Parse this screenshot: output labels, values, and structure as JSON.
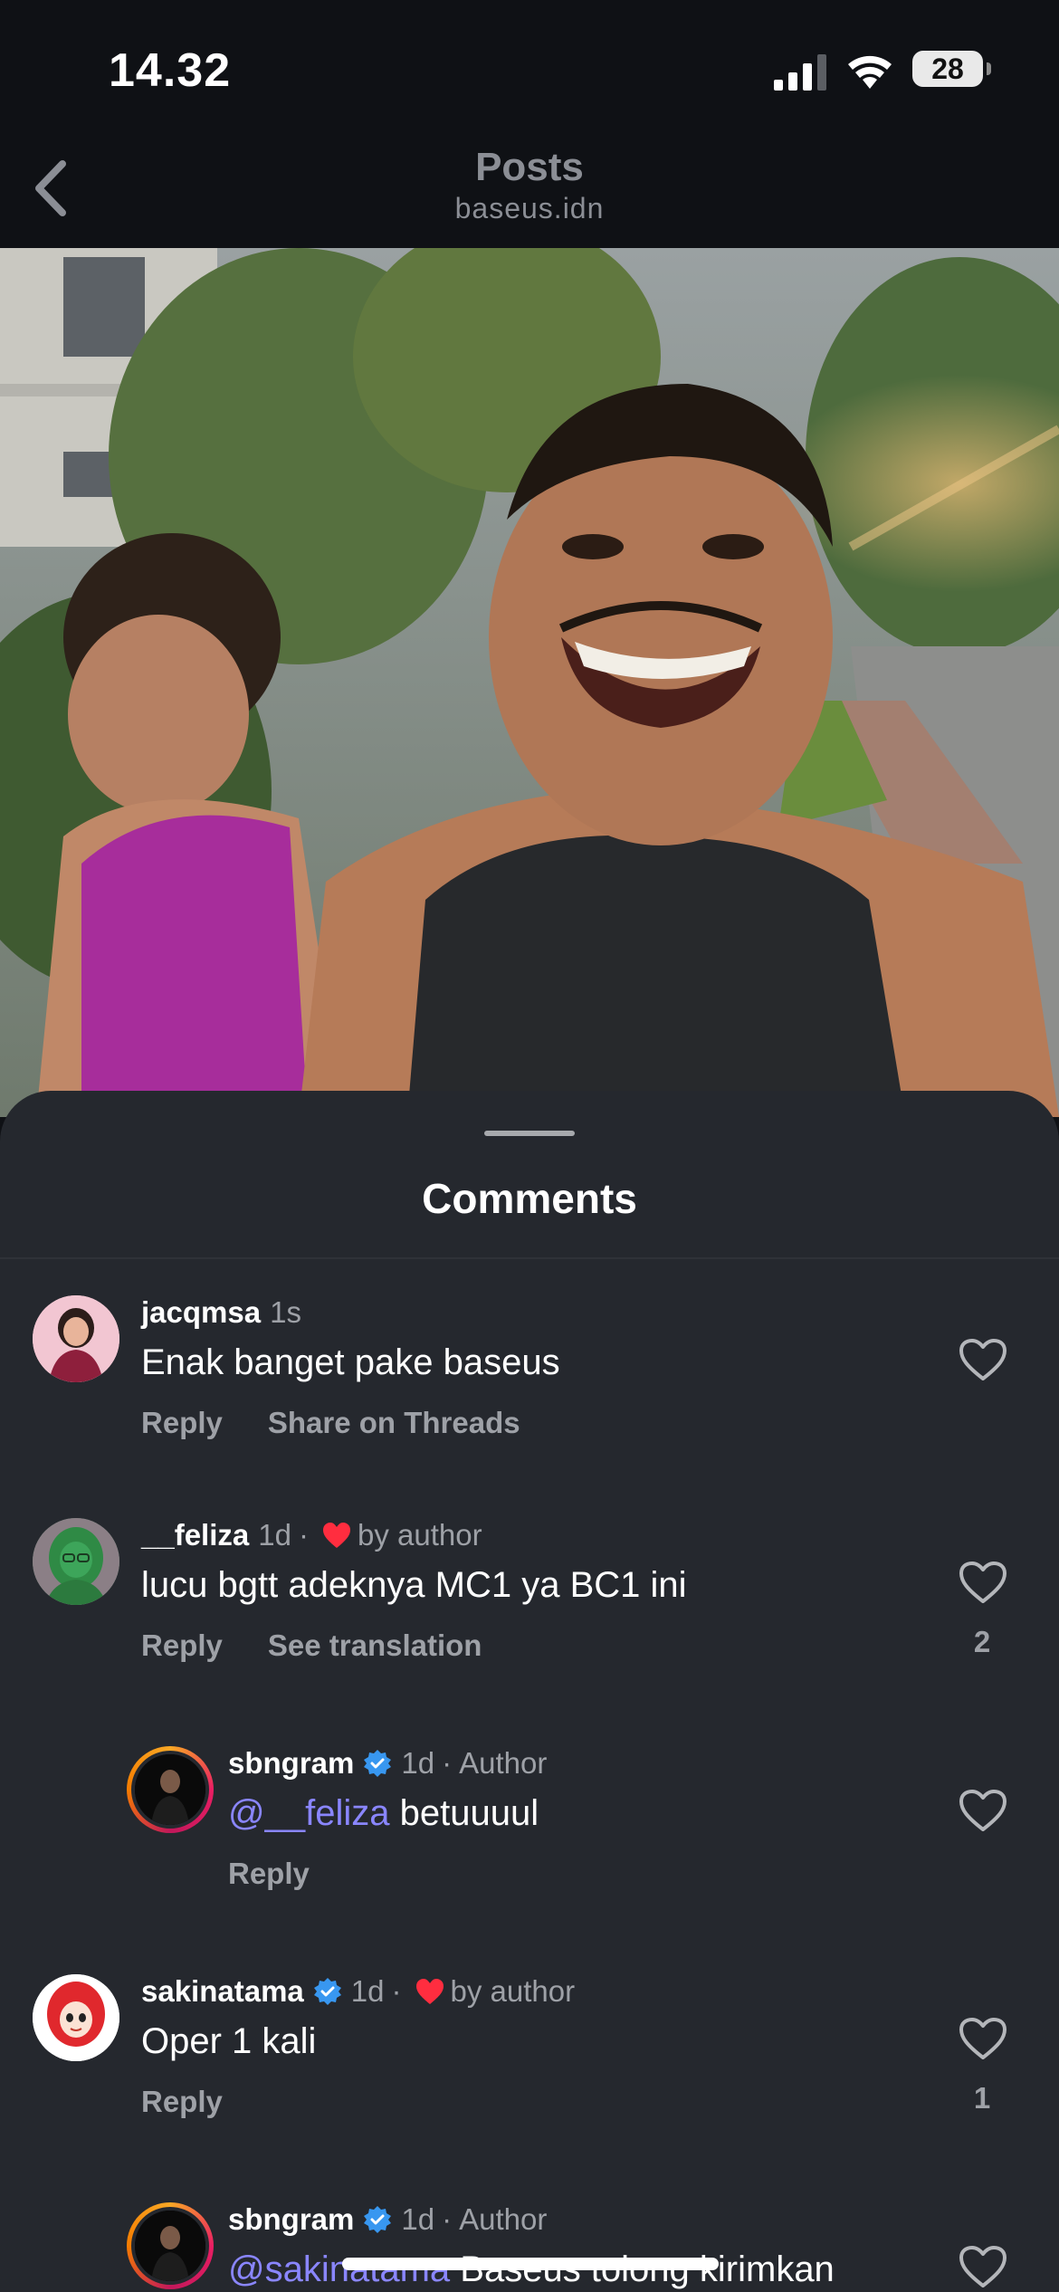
{
  "status_bar": {
    "time": "14.32",
    "battery": "28"
  },
  "header": {
    "title": "Posts",
    "subtitle": "baseus.idn"
  },
  "sheet": {
    "title": "Comments"
  },
  "comments": [
    {
      "username": "jacqmsa",
      "time": "1s",
      "text": "Enak banget pake baseus",
      "reply_label": "Reply",
      "extra_action": "Share on Threads"
    },
    {
      "username": "__feliza",
      "time": "1d",
      "liked_by_author": "by author",
      "text": "lucu bgtt adeknya MC1 ya BC1 ini",
      "reply_label": "Reply",
      "extra_action": "See translation",
      "like_count": "2"
    },
    {
      "username": "sbngram",
      "time": "1d",
      "author_label": "Author",
      "mention": "@__feliza",
      "text": " betuuuul",
      "reply_label": "Reply"
    },
    {
      "username": "sakinatama",
      "time": "1d",
      "liked_by_author": "by author",
      "text": "Oper 1 kali",
      "reply_label": "Reply",
      "like_count": "1"
    },
    {
      "username": "sbngram",
      "time": "1d",
      "author_label": "Author",
      "mention": "@sakinatama",
      "text": " Baseus tolong kirimkan"
    }
  ],
  "colors": {
    "accent_mention": "#8a86ff",
    "verified_blue": "#3897f0",
    "heart_red": "#ff2d3f"
  }
}
